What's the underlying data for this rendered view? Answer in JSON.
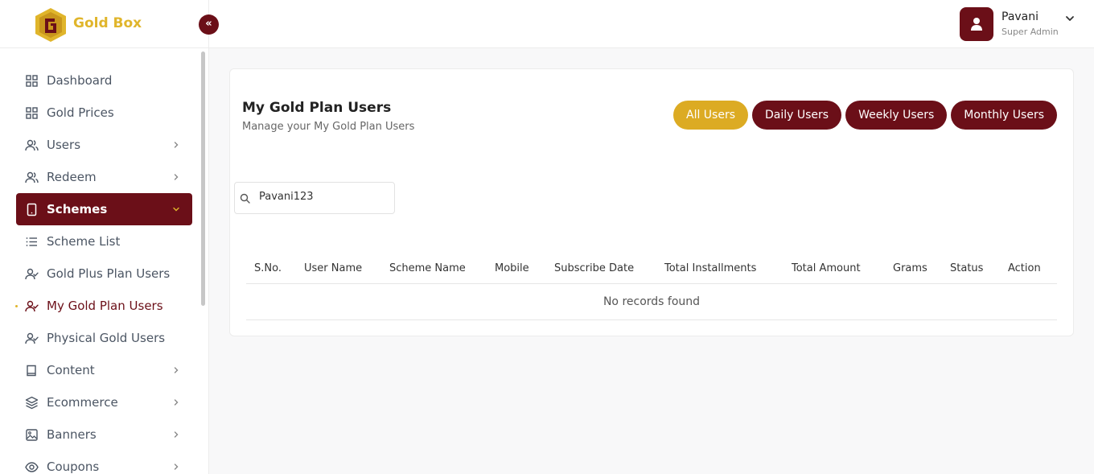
{
  "brand": {
    "name": "Gold Box"
  },
  "header": {
    "user_name": "Pavani",
    "user_role": "Super Admin"
  },
  "sidebar": {
    "items": [
      {
        "label": "Dashboard",
        "icon": "grid-icon",
        "chevron": false
      },
      {
        "label": "Gold Prices",
        "icon": "grid-icon",
        "chevron": false
      },
      {
        "label": "Users",
        "icon": "users-icon",
        "chevron": true
      },
      {
        "label": "Redeem",
        "icon": "users-icon",
        "chevron": true
      },
      {
        "label": "Schemes",
        "icon": "tablet-icon",
        "chevron": true,
        "active": true
      },
      {
        "label": "Scheme List",
        "icon": "list-icon",
        "chevron": false
      },
      {
        "label": "Gold Plus Plan Users",
        "icon": "user-check-icon",
        "chevron": false
      },
      {
        "label": "My Gold Plan Users",
        "icon": "user-check-icon",
        "chevron": false,
        "current": true
      },
      {
        "label": "Physical Gold Users",
        "icon": "user-check-icon",
        "chevron": false
      },
      {
        "label": "Content",
        "icon": "book-icon",
        "chevron": true
      },
      {
        "label": "Ecommerce",
        "icon": "layers-icon",
        "chevron": true
      },
      {
        "label": "Banners",
        "icon": "image-icon",
        "chevron": true
      },
      {
        "label": "Coupons",
        "icon": "eye-icon",
        "chevron": true
      }
    ]
  },
  "main": {
    "title": "My Gold Plan Users",
    "subtitle": "Manage your My Gold Plan Users",
    "filters": [
      "All Users",
      "Daily Users",
      "Weekly Users",
      "Monthly Users"
    ],
    "active_filter": "All Users",
    "search_value": "Pavani123",
    "table": {
      "columns": [
        "S.No.",
        "User Name",
        "Scheme Name",
        "Mobile",
        "Subscribe Date",
        "Total Installments",
        "Total Amount",
        "Grams",
        "Status",
        "Action"
      ],
      "empty_text": "No records found"
    }
  },
  "colors": {
    "primary": "#6b0f18",
    "accent": "#dcab23"
  }
}
